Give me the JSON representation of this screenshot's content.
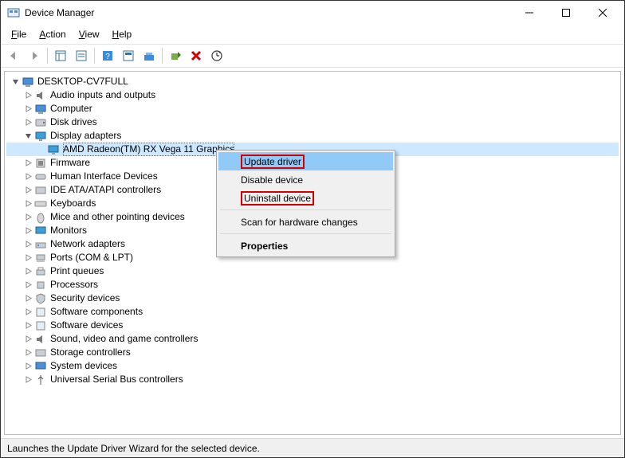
{
  "window": {
    "title": "Device Manager"
  },
  "menu": {
    "file": "File",
    "action": "Action",
    "view": "View",
    "help": "Help"
  },
  "tree": {
    "root": "DESKTOP-CV7FULL",
    "items": [
      "Audio inputs and outputs",
      "Computer",
      "Disk drives",
      "Display adapters",
      "Firmware",
      "Human Interface Devices",
      "IDE ATA/ATAPI controllers",
      "Keyboards",
      "Mice and other pointing devices",
      "Monitors",
      "Network adapters",
      "Ports (COM & LPT)",
      "Print queues",
      "Processors",
      "Security devices",
      "Software components",
      "Software devices",
      "Sound, video and game controllers",
      "Storage controllers",
      "System devices",
      "Universal Serial Bus controllers"
    ],
    "display_adapter_child": "AMD Radeon(TM) RX Vega 11 Graphics"
  },
  "context_menu": {
    "update": "Update driver",
    "disable": "Disable device",
    "uninstall": "Uninstall device",
    "scan": "Scan for hardware changes",
    "properties": "Properties"
  },
  "statusbar": "Launches the Update Driver Wizard for the selected device."
}
